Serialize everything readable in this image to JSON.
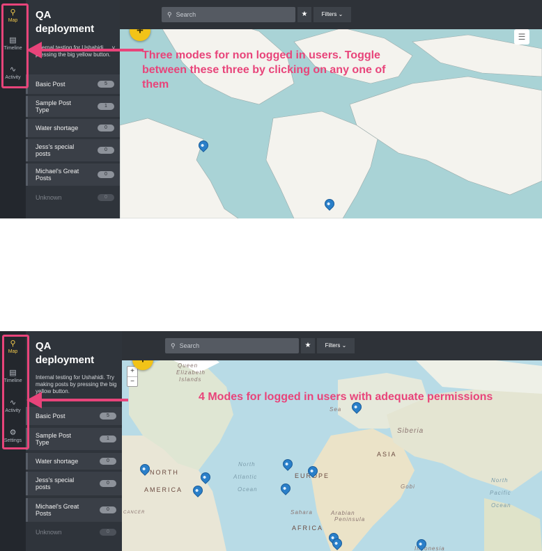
{
  "colors": {
    "accent_yellow": "#f2c318",
    "annotation_pink": "#e8447a",
    "sidebar_bg": "#2f343b",
    "rail_bg": "#23272d",
    "pin_blue": "#2a7fc9"
  },
  "top": {
    "rail": [
      {
        "label": "Map",
        "icon": "map-pin-icon",
        "active": true
      },
      {
        "label": "Timeline",
        "icon": "timeline-icon",
        "active": false
      },
      {
        "label": "Activity",
        "icon": "activity-icon",
        "active": false
      }
    ],
    "title": "QA deployment",
    "description": "Internal testing for Ushahidi. Try making posts by pressing the big yellow button.",
    "description_visible": "Internal testing for Ushahidi. …y pressing the big yellow button.",
    "categories": [
      {
        "name": "Basic Post",
        "count": "5"
      },
      {
        "name": "Sample Post Type",
        "count": "1"
      },
      {
        "name": "Water shortage",
        "count": "0"
      },
      {
        "name": "Jess's special posts",
        "count": "0"
      },
      {
        "name": "Michael's Great Posts",
        "count": "0"
      },
      {
        "name": "Unknown",
        "count": "0"
      }
    ],
    "search_placeholder": "Search",
    "star": "★",
    "filters": "Filters ⌄",
    "fab": "+",
    "annotation": "Three modes for non logged in users. Toggle between these three by clicking on any one of them"
  },
  "bottom": {
    "rail": [
      {
        "label": "Map",
        "icon": "map-pin-icon",
        "active": true
      },
      {
        "label": "Timeline",
        "icon": "timeline-icon",
        "active": false
      },
      {
        "label": "Activity",
        "icon": "activity-icon",
        "active": false
      },
      {
        "label": "Settings",
        "icon": "gear-icon",
        "active": false
      }
    ],
    "title": "QA deployment",
    "description": "Internal testing for Ushahidi. Try making posts by pressing the big yellow button.",
    "categories": [
      {
        "name": "Basic Post",
        "count": "5"
      },
      {
        "name": "Sample Post Type",
        "count": "1"
      },
      {
        "name": "Water shortage",
        "count": "0"
      },
      {
        "name": "Jess's special posts",
        "count": "0"
      },
      {
        "name": "Michael's Great Posts",
        "count": "0"
      },
      {
        "name": "Unknown",
        "count": "0"
      }
    ],
    "search_placeholder": "Search",
    "star": "★",
    "filters": "Filters ⌄",
    "fab": "+",
    "zoom_in": "+",
    "zoom_out": "−",
    "annotation": "4 Modes for logged in users with adequate permissions",
    "map_labels": {
      "siberia": "Siberia",
      "asia": "ASIA",
      "north_america": "NORTH",
      "america": "AMERICA",
      "europe": "EUROPE",
      "north_atlantic": "North",
      "atlantic": "Atlantic",
      "ocean": "Ocean",
      "gobi": "Gobi",
      "north_pacific": "North",
      "pacific": "Pacific",
      "ocean2": "Ocean",
      "sahara": "Sahara",
      "arabian": "Arabian",
      "peninsula": "Peninsula",
      "africa": "AFRICA",
      "queen": "Queen",
      "elizabeth": "Elizabeth",
      "islands": "Islands",
      "indonesia": "Indonesia",
      "sea": "Sea",
      "cancer": "CANCER"
    }
  }
}
